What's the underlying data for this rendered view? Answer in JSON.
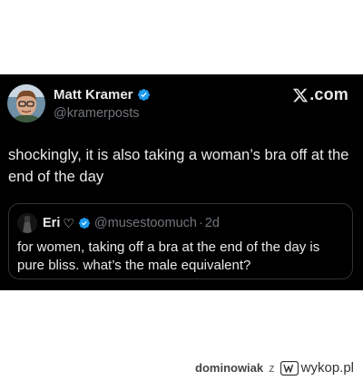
{
  "tweet": {
    "author_name": "Matt Kramer",
    "author_handle": "@kramerposts",
    "site_label": ".com",
    "text": "shockingly, it is also taking a woman’s bra off at the end of the day"
  },
  "quoted_tweet": {
    "author_name": "Eri",
    "heart": "♡",
    "author_handle": "@musestoomuch",
    "separator": "·",
    "time": "2d",
    "text": "for women, taking off a bra at the end of the day is pure bliss. what’s the male equivalent?"
  },
  "footer": {
    "username": "dominowiak",
    "connector": "z",
    "site": "wykop.pl"
  },
  "colors": {
    "card_bg": "#000000",
    "verified": "#1d9bf0",
    "primary_text": "#e7e9ea",
    "secondary_text": "#71767b"
  },
  "icons": [
    "verified-badge-icon",
    "x-logo-icon",
    "wykop-logo-icon"
  ]
}
